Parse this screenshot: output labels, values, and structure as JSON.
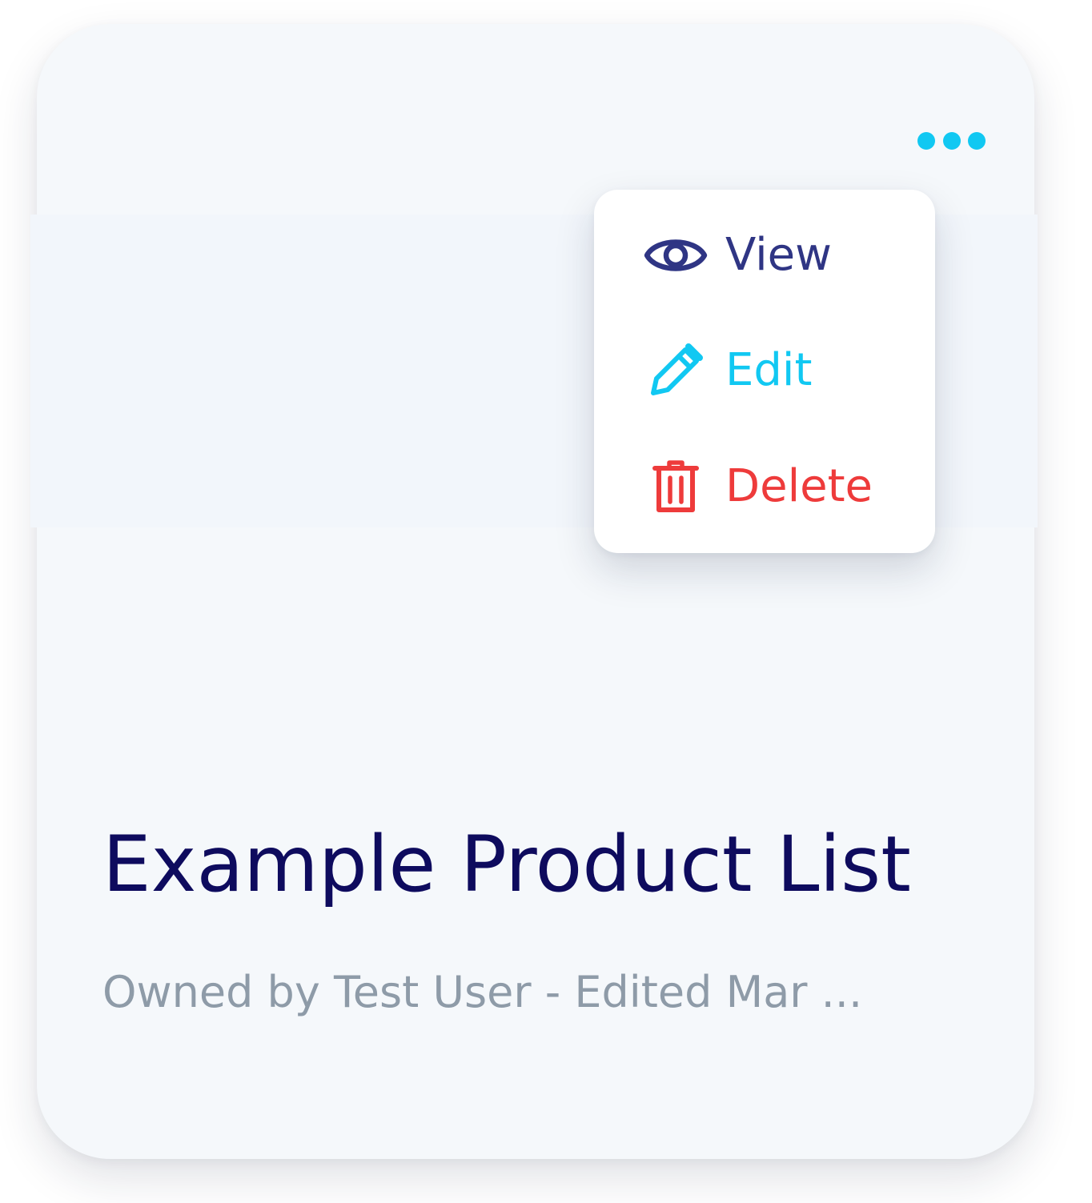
{
  "card": {
    "title": "Example Product List",
    "subtitle": "Owned by Test User - Edited Mar ..."
  },
  "more_button": {
    "icon": "more-horizontal-icon"
  },
  "menu": {
    "items": [
      {
        "label": "View",
        "icon": "eye-icon",
        "color": "#2f3584"
      },
      {
        "label": "Edit",
        "icon": "pencil-icon",
        "color": "#11c8f2"
      },
      {
        "label": "Delete",
        "icon": "trash-icon",
        "color": "#ee3b3b"
      }
    ]
  },
  "colors": {
    "card_bg": "#f5f8fb",
    "accent": "#11c8f2",
    "title": "#0e0b5e",
    "subtitle": "#8e9ba8",
    "danger": "#ee3b3b"
  }
}
